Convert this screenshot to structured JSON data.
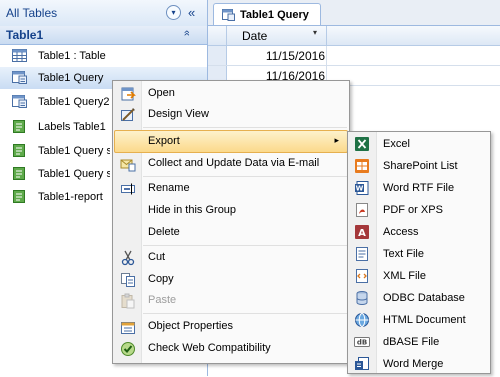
{
  "nav": {
    "header_title": "All Tables",
    "dropdown_glyph": "▾",
    "collapse_glyph": "«",
    "group_title": "Table1",
    "group_collapse_glyph": "»",
    "items": [
      {
        "label": "Table1 : Table",
        "icon": "table-icon"
      },
      {
        "label": "Table1 Query",
        "icon": "query-icon"
      },
      {
        "label": "Table1 Query2",
        "icon": "query-icon"
      },
      {
        "label": "Labels Table1",
        "icon": "report-icon"
      },
      {
        "label": "Table1 Query s",
        "icon": "report-icon"
      },
      {
        "label": "Table1 Query s",
        "icon": "report-icon"
      },
      {
        "label": "Table1-report",
        "icon": "report-icon"
      }
    ]
  },
  "document": {
    "tab_label": "Table1 Query",
    "column_header": "Date",
    "column_dropdown_glyph": "▾",
    "rows": [
      "11/15/2016",
      "11/16/2016"
    ]
  },
  "context_menu": {
    "items": [
      {
        "label": "Open",
        "icon": "open-icon"
      },
      {
        "label": "Design View",
        "icon": "design-view-icon"
      },
      {
        "label": "Export",
        "icon": "",
        "submenu_arrow": "▸"
      },
      {
        "label": "Collect and Update Data via E-mail",
        "icon": "collect-data-icon"
      },
      {
        "label": "Rename",
        "icon": "rename-icon"
      },
      {
        "label": "Hide in this Group",
        "icon": ""
      },
      {
        "label": "Delete",
        "icon": ""
      },
      {
        "label": "Cut",
        "icon": "cut-icon"
      },
      {
        "label": "Copy",
        "icon": "copy-icon"
      },
      {
        "label": "Paste",
        "icon": "paste-icon"
      },
      {
        "label": "Object Properties",
        "icon": "properties-icon"
      },
      {
        "label": "Check Web Compatibility",
        "icon": "web-check-icon"
      }
    ]
  },
  "export_submenu": {
    "items": [
      {
        "label": "Excel",
        "icon": "excel-icon"
      },
      {
        "label": "SharePoint List",
        "icon": "sharepoint-icon"
      },
      {
        "label": "Word RTF File",
        "icon": "word-icon"
      },
      {
        "label": "PDF or XPS",
        "icon": "pdf-icon"
      },
      {
        "label": "Access",
        "icon": "access-icon"
      },
      {
        "label": "Text File",
        "icon": "text-file-icon"
      },
      {
        "label": "XML File",
        "icon": "xml-file-icon"
      },
      {
        "label": "ODBC Database",
        "icon": "odbc-icon"
      },
      {
        "label": "HTML Document",
        "icon": "html-icon"
      },
      {
        "label": "dBASE File",
        "icon": "dbase-icon"
      },
      {
        "label": "Word Merge",
        "icon": "word-merge-icon"
      }
    ]
  },
  "colors": {
    "accent": "#15428b",
    "highlight": "#fbd98b",
    "selection": "#c9dcf3",
    "excel_green": "#1e7145",
    "word_blue": "#2b5797",
    "access_red": "#a4373a",
    "pdf_red": "#c8371f"
  }
}
